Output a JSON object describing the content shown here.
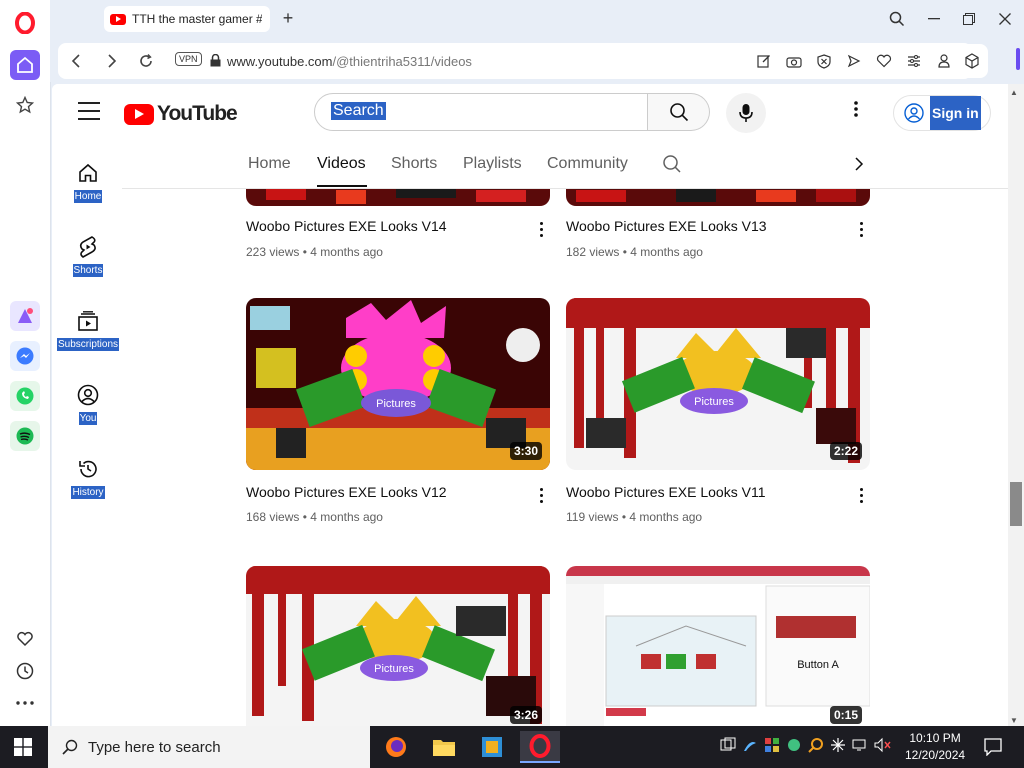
{
  "browser": {
    "tab_title": "TTH the master gamer #Gi",
    "new_tab_label": "+",
    "vpn_label": "VPN",
    "url_host": "www.youtube.com",
    "url_path": "/@thientriha5311/videos"
  },
  "youtube": {
    "logo_text": "YouTube",
    "search_placeholder": "Search",
    "signin_label": "Sign in"
  },
  "left_nav": [
    {
      "label": "Home",
      "icon": "home-icon"
    },
    {
      "label": "Shorts",
      "icon": "shorts-icon"
    },
    {
      "label": "Subscriptions",
      "icon": "subscriptions-icon"
    },
    {
      "label": "You",
      "icon": "you-icon"
    },
    {
      "label": "History",
      "icon": "history-icon"
    }
  ],
  "channel_tabs": [
    "Home",
    "Videos",
    "Shorts",
    "Playlists",
    "Community"
  ],
  "active_tab": "Videos",
  "videos": [
    {
      "title": "Woobo Pictures EXE Looks V14",
      "views": "223 views",
      "age": "4 months ago"
    },
    {
      "title": "Woobo Pictures EXE Looks V13",
      "views": "182 views",
      "age": "4 months ago"
    },
    {
      "title": "Woobo Pictures EXE Looks V12",
      "views": "168 views",
      "age": "4 months ago",
      "duration": "3:30"
    },
    {
      "title": "Woobo Pictures EXE Looks V11",
      "views": "119 views",
      "age": "4 months ago",
      "duration": "2:22"
    },
    {
      "title": "",
      "views": "",
      "age": "",
      "duration": "3:26"
    },
    {
      "title": "",
      "views": "",
      "age": "",
      "duration": "0:15"
    }
  ],
  "meta_separator": "•",
  "thumb_texts": {
    "pictures": "Pictures",
    "button_a": "Button A"
  },
  "taskbar": {
    "search_placeholder": "Type here to search",
    "time": "10:10 PM",
    "date": "12/20/2024"
  },
  "colors": {
    "youtube_red": "#ff0000",
    "selection_blue": "#2c63c5",
    "opera_purple": "#7b5cf5",
    "taskbar": "#1c1c22"
  }
}
